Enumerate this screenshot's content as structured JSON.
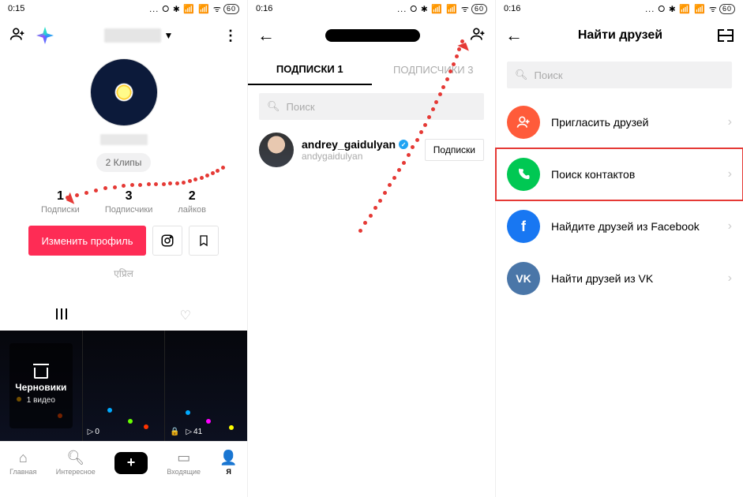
{
  "status": {
    "time1": "0:15",
    "time2": "0:16",
    "time3": "0:16",
    "icons": "…",
    "battery": "60"
  },
  "p1": {
    "clips_chip": "2 Клипы",
    "stats": {
      "following": {
        "num": "1",
        "label": "Подписки"
      },
      "followers": {
        "num": "3",
        "label": "Подписчики"
      },
      "likes": {
        "num": "2",
        "label": "лайков"
      }
    },
    "edit_profile": "Изменить профиль",
    "hindi": "एप्रिल",
    "drafts": {
      "title": "Черновики",
      "sub": "1 видео"
    },
    "thumb2_count": "0",
    "thumb3_count": "41",
    "nav": {
      "home": "Главная",
      "discover": "Интересное",
      "inbox": "Входящие",
      "me": "Я"
    }
  },
  "p2": {
    "tabs": {
      "following": "ПОДПИСКИ 1",
      "followers": "ПОДПИСЧИКИ 3"
    },
    "search_placeholder": "Поиск",
    "user": {
      "name": "andrey_gaidulyan",
      "handle": "andygaidulyan"
    },
    "btn_following": "Подписки"
  },
  "p3": {
    "title": "Найти друзей",
    "search_placeholder": "Поиск",
    "options": {
      "invite": "Пригласить друзей",
      "contacts": "Поиск контактов",
      "facebook": "Найдите друзей из Facebook",
      "vk": "Найти друзей из VK"
    }
  }
}
